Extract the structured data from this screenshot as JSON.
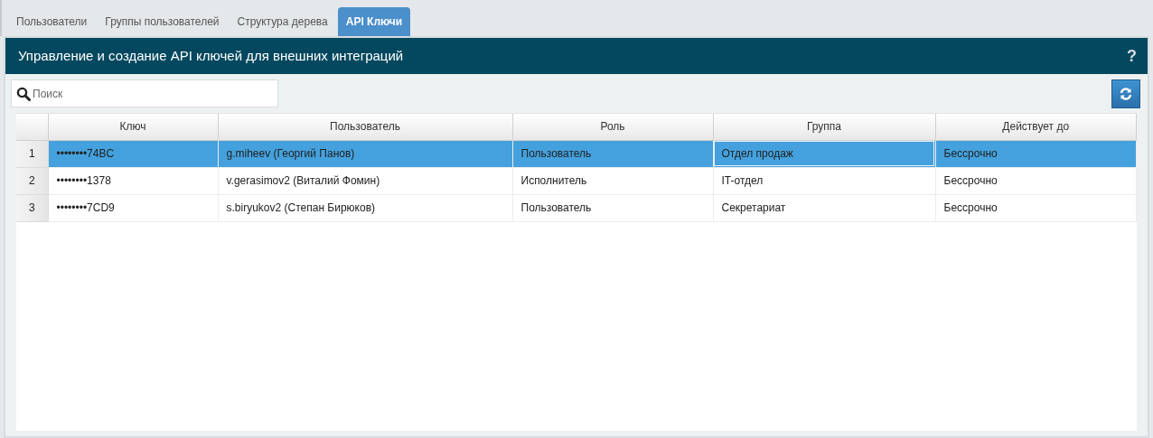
{
  "tabs": [
    {
      "label": "Пользователи",
      "selected": false
    },
    {
      "label": "Группы пользователей",
      "selected": false
    },
    {
      "label": "Структура дерева",
      "selected": false
    },
    {
      "label": "API Ключи",
      "selected": true
    }
  ],
  "panel": {
    "title": "Управление и создание API ключей для внешних интеграций",
    "help": "?"
  },
  "search": {
    "placeholder": "Поиск"
  },
  "table": {
    "columns": [
      "Ключ",
      "Пользователь",
      "Роль",
      "Группа",
      "Действует до"
    ],
    "rows": [
      {
        "number": "1",
        "selected": true,
        "cells": [
          {
            "text": "••••••••74BC",
            "focused": false
          },
          {
            "text": "g.miheev (Георгий Панов)",
            "focused": false
          },
          {
            "text": "Пользователь",
            "focused": false
          },
          {
            "text": "Отдел продаж",
            "focused": true
          },
          {
            "text": "Бессрочно",
            "focused": false
          }
        ]
      },
      {
        "number": "2",
        "selected": false,
        "cells": [
          {
            "text": "••••••••1378",
            "focused": false
          },
          {
            "text": "v.gerasimov2 (Виталий Фомин)",
            "focused": false
          },
          {
            "text": "Исполнитель",
            "focused": false
          },
          {
            "text": "IT-отдел",
            "focused": false
          },
          {
            "text": "Бессрочно",
            "focused": false
          }
        ]
      },
      {
        "number": "3",
        "selected": false,
        "cells": [
          {
            "text": "••••••••7CD9",
            "focused": false
          },
          {
            "text": "s.biryukov2 (Степан Бирюков)",
            "focused": false
          },
          {
            "text": "Пользователь",
            "focused": false
          },
          {
            "text": "Секретариат",
            "focused": false
          },
          {
            "text": "Бессрочно",
            "focused": false
          }
        ]
      }
    ]
  }
}
